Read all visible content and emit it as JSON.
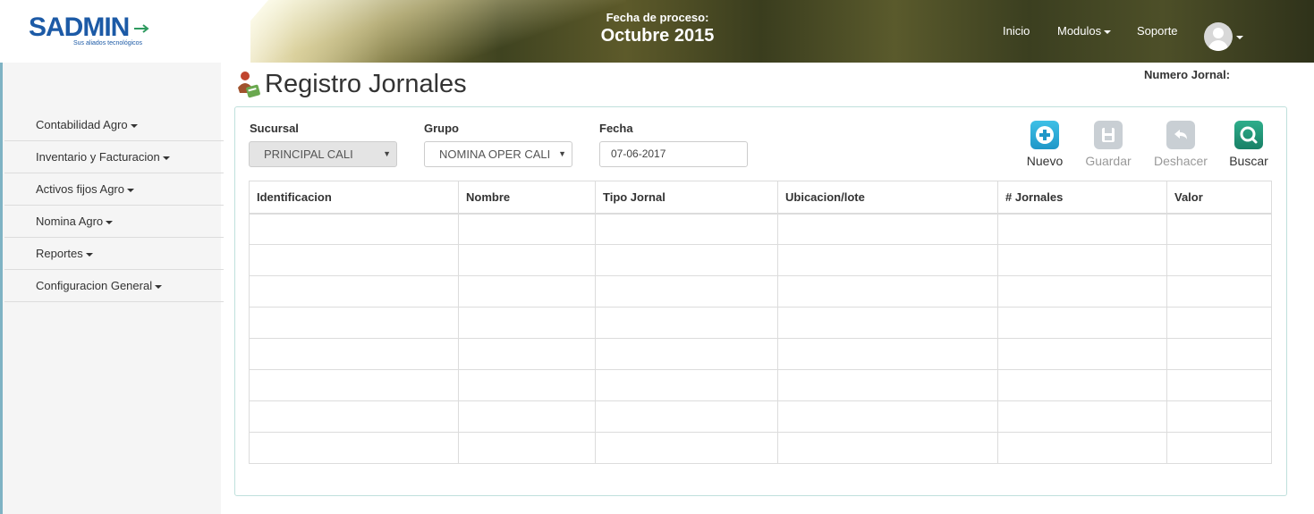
{
  "app": {
    "logo_main": "SADMIN",
    "logo_tagline": "Sus aliados tecnológicos"
  },
  "header": {
    "fecha_label": "Fecha de proceso:",
    "fecha_value": "Octubre 2015",
    "nav": {
      "inicio": "Inicio",
      "modulos": "Modulos",
      "soporte": "Soporte"
    }
  },
  "sidebar": {
    "items": [
      {
        "label": "Contabilidad Agro"
      },
      {
        "label": "Inventario y Facturacion"
      },
      {
        "label": "Activos fijos Agro"
      },
      {
        "label": "Nomina Agro"
      },
      {
        "label": "Reportes"
      },
      {
        "label": "Configuracion General"
      }
    ]
  },
  "page": {
    "title": "Registro Jornales",
    "numero_jornal_label": "Numero Jornal:"
  },
  "form": {
    "sucursal_label": "Sucursal",
    "sucursal_value": "PRINCIPAL CALI",
    "grupo_label": "Grupo",
    "grupo_value": "NOMINA OPER CALI",
    "fecha_label": "Fecha",
    "fecha_value": "07-06-2017"
  },
  "actions": {
    "nuevo": "Nuevo",
    "guardar": "Guardar",
    "deshacer": "Deshacer",
    "buscar": "Buscar"
  },
  "table": {
    "columns": [
      "Identificacion",
      "Nombre",
      "Tipo Jornal",
      "Ubicacion/lote",
      "# Jornales",
      "Valor"
    ],
    "empty_rows": 8
  },
  "colors": {
    "accent": "#1f97c8",
    "search": "#198066",
    "sidebar_bg": "#f5f5f5",
    "panel_border": "#bfe0dc"
  }
}
